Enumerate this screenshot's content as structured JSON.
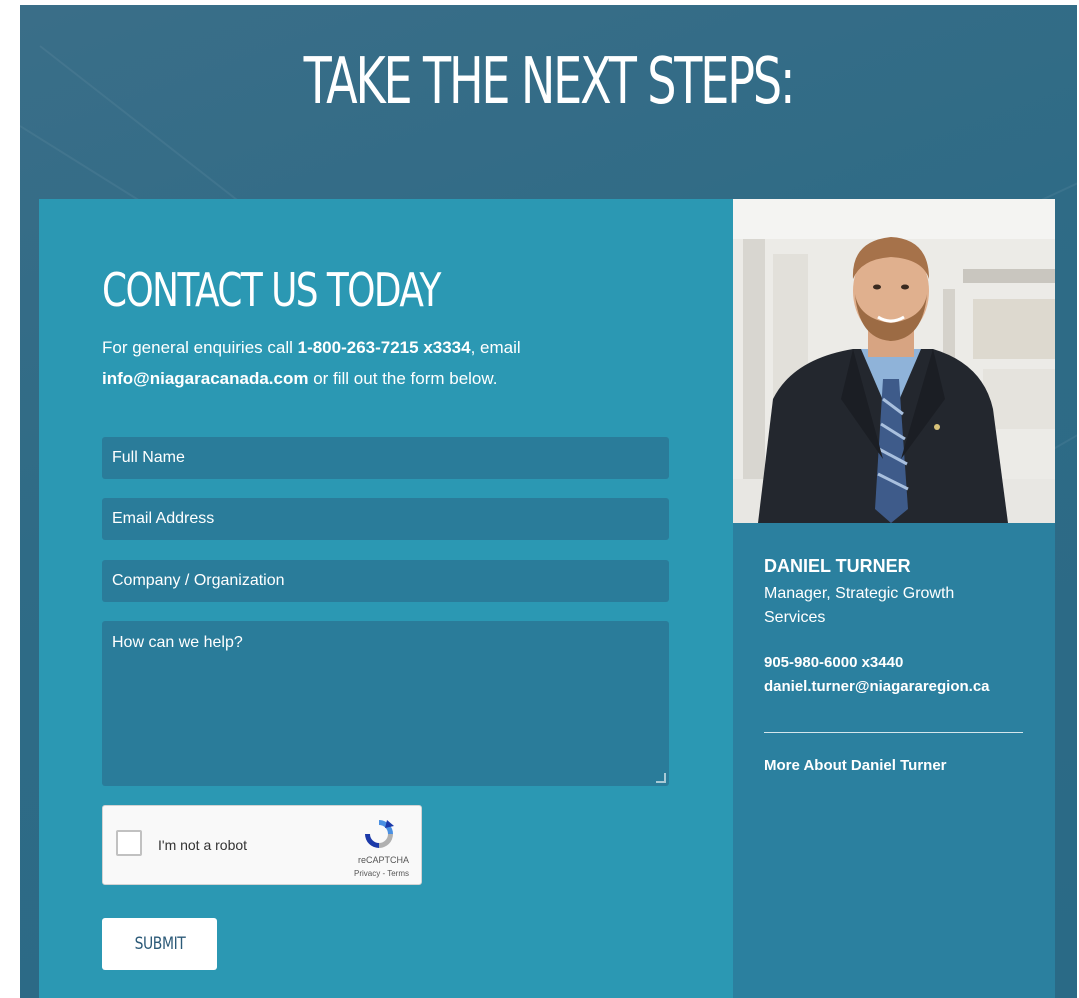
{
  "hero": {
    "title": "TAKE THE NEXT STEPS:"
  },
  "contact": {
    "heading": "CONTACT US TODAY",
    "intro_prefix": "For general enquiries call ",
    "phone": "1-800-263-7215 x3334",
    "intro_mid": ", email ",
    "email": "info@niagaracanada.com",
    "intro_suffix": " or fill out the form below."
  },
  "form": {
    "full_name_placeholder": "Full Name",
    "email_placeholder": "Email Address",
    "company_placeholder": "Company / Organization",
    "message_placeholder": "How can we help?",
    "submit_label": "SUBMIT"
  },
  "captcha": {
    "label": "I'm not a robot",
    "brand": "reCAPTCHA",
    "links": "Privacy - Terms",
    "checked": false
  },
  "profile": {
    "name": "DANIEL TURNER",
    "role": "Manager, Strategic Growth Services",
    "phone": "905-980-6000 x3440",
    "email": "daniel.turner@niagararegion.ca",
    "more_link": "More About Daniel Turner"
  },
  "colors": {
    "background": "#2f6b86",
    "contact_panel": "#2b98b3",
    "profile_panel": "#2b809f",
    "field": "#2a7c9a",
    "submit_text": "#2c5a78"
  },
  "icons": {
    "captcha": "recaptcha-icon",
    "resize": "resize-grip-icon"
  }
}
